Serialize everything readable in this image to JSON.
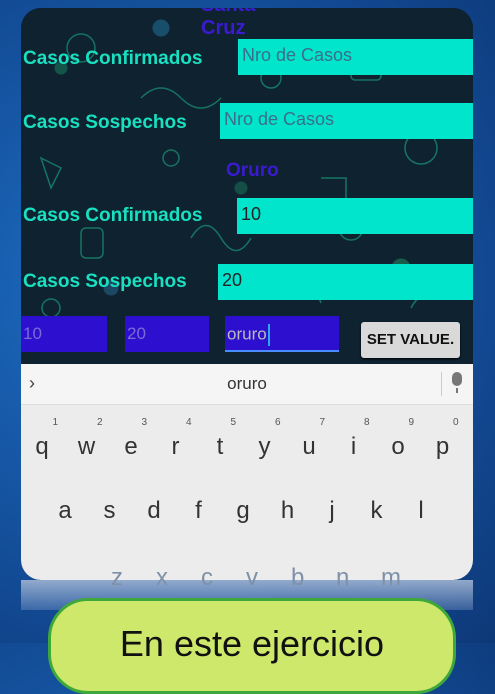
{
  "app": {
    "header_partial": "Santa Cruz",
    "top": {
      "confirmed_label": "Casos Confirmados",
      "confirmed_placeholder": "Nro de Casos",
      "suspected_label": "Casos Sospechos",
      "suspected_placeholder": "Nro de Casos"
    },
    "city": "Oruro",
    "city_block": {
      "confirmed_label": "Casos Confirmados",
      "confirmed_value": "10",
      "suspected_label": "Casos Sospechos",
      "suspected_value": "20"
    },
    "bottom_inputs": [
      "10",
      "20",
      "oruro"
    ],
    "set_button": "SET VALUE."
  },
  "keyboard": {
    "suggestion": "oruro",
    "row1": [
      {
        "k": "q",
        "h": "1"
      },
      {
        "k": "w",
        "h": "2"
      },
      {
        "k": "e",
        "h": "3"
      },
      {
        "k": "r",
        "h": "4"
      },
      {
        "k": "t",
        "h": "5"
      },
      {
        "k": "y",
        "h": "6"
      },
      {
        "k": "u",
        "h": "7"
      },
      {
        "k": "i",
        "h": "8"
      },
      {
        "k": "o",
        "h": "9"
      },
      {
        "k": "p",
        "h": "0"
      }
    ],
    "row2": [
      "a",
      "s",
      "d",
      "f",
      "g",
      "h",
      "j",
      "k",
      "l"
    ],
    "row3_ghost": [
      "z",
      "x",
      "c",
      "v",
      "b",
      "n",
      "m"
    ]
  },
  "caption": "En este ejercicio"
}
